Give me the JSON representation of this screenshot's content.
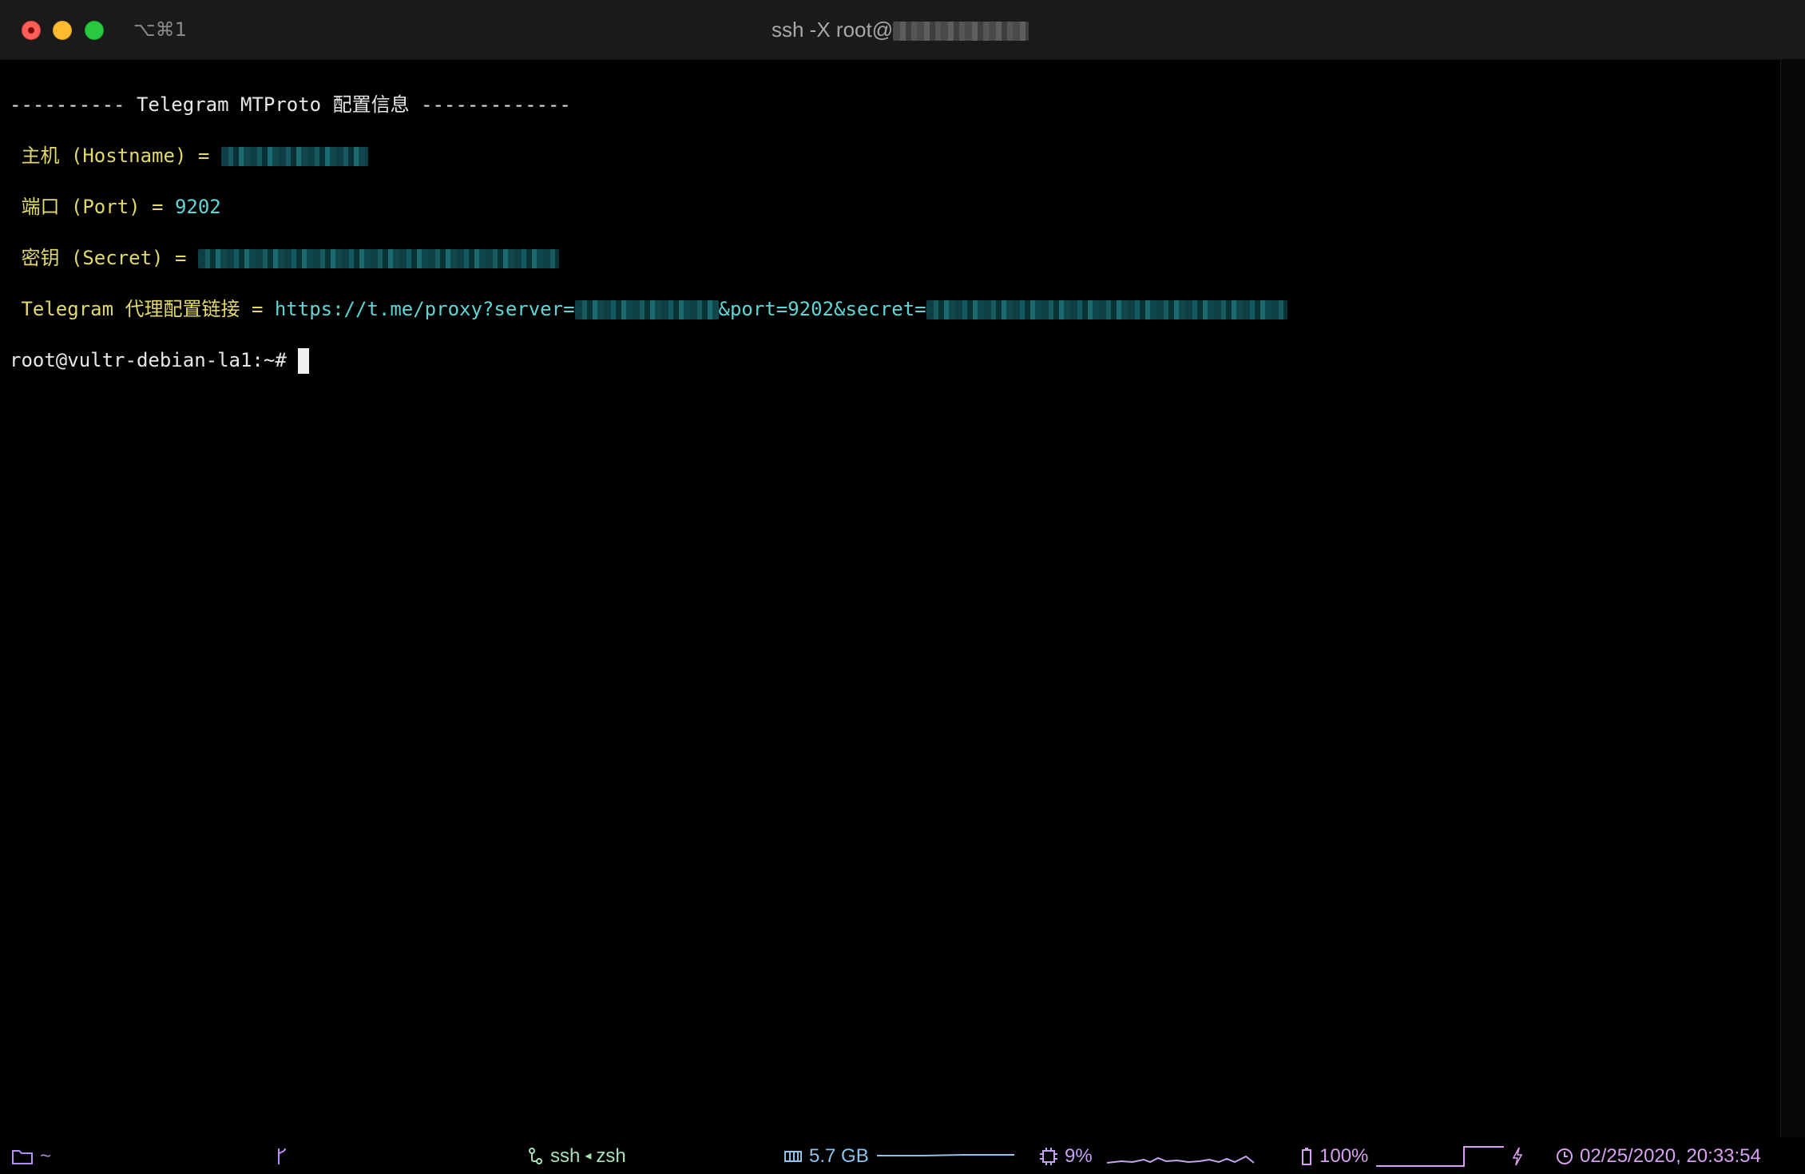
{
  "window": {
    "tab_shortcut": "⌥⌘1",
    "title_prefix": "ssh -X root@"
  },
  "terminal": {
    "header": "---------- Telegram MTProto 配置信息 -------------",
    "hostname_label": " 主机 (Hostname) = ",
    "port_label": " 端口 (Port) = ",
    "port_value": "9202",
    "secret_label": " 密钥 (Secret) = ",
    "link_label": " Telegram 代理配置链接 = ",
    "link_prefix": "https://t.me/proxy?server=",
    "link_middle": "&port=9202&secret=",
    "prompt": "root@vultr-debian-la1:~# "
  },
  "statusbar": {
    "cwd": "~",
    "job": "ssh",
    "job_separator": "◂",
    "shell": "zsh",
    "memory": "5.7 GB",
    "cpu": "9%",
    "battery": "100%",
    "datetime": "02/25/2020, 20:33:54",
    "colors": {
      "folder": "#b58df0",
      "job": "#a9e0b8",
      "memory": "#8cc4f0",
      "cpu": "#c7a2f5",
      "battery": "#d7a0f0"
    },
    "icons": [
      "folder-icon",
      "git-branch-icon",
      "process-icon",
      "memory-icon",
      "cpu-icon",
      "battery-icon",
      "charging-icon",
      "clock-icon"
    ]
  }
}
